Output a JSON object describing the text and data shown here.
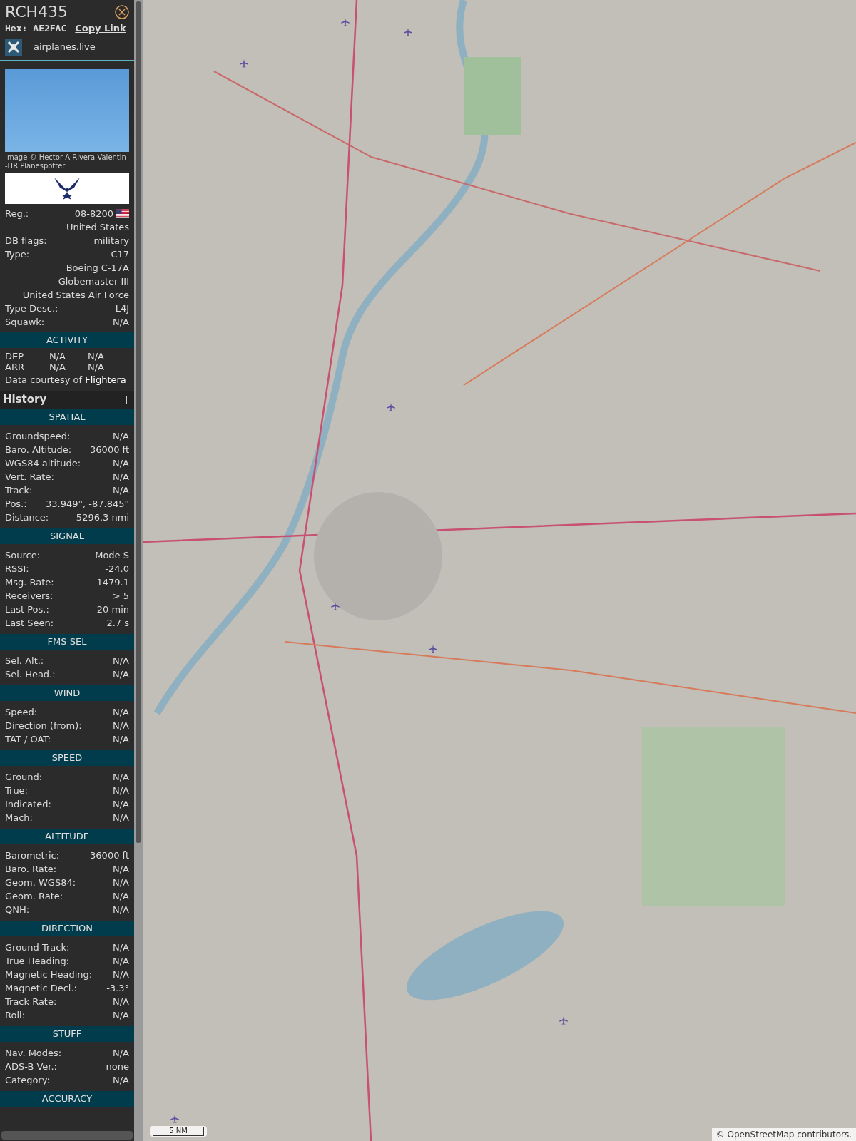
{
  "header": {
    "callsign": "RCH435",
    "hex_label": "Hex:",
    "hex": "AE2FAC",
    "copy_link": "Copy Link",
    "site": "airplanes.live"
  },
  "photo": {
    "credit": "Image © Hector A Rivera Valentin -HR Planespotter"
  },
  "details": [
    {
      "label": "Reg.:",
      "value": "08-8200",
      "flag": true
    },
    {
      "value": "United States",
      "flag": false
    },
    {
      "label": "DB flags:",
      "value": "military",
      "flag": false
    },
    {
      "label": "Type:",
      "value": "C17",
      "flag": false
    },
    {
      "value": "Boeing C-17A Globemaster III",
      "flag": false
    },
    {
      "value": "United States Air Force",
      "flag": false
    },
    {
      "label": "Type Desc.:",
      "value": "L4J",
      "flag": false
    },
    {
      "label": "Squawk:",
      "value": "N/A",
      "flag": false
    }
  ],
  "activity": {
    "title": "ACTIVITY",
    "rows": [
      [
        "DEP",
        "N/A",
        "N/A"
      ],
      [
        "ARR",
        "N/A",
        "N/A"
      ]
    ],
    "courtesy": "Data courtesy of **Flightera**"
  },
  "history": {
    "title": "History",
    "sections": [
      {
        "title": "SPATIAL",
        "rows": [
          {
            "label": "Groundspeed:",
            "value": "N/A"
          },
          {
            "label": "Baro. Altitude:",
            "value": "36000 ft"
          },
          {
            "label": "WGS84 altitude:",
            "value": "N/A"
          },
          {
            "label": "Vert. Rate:",
            "value": "N/A"
          },
          {
            "label": "Track:",
            "value": "N/A"
          },
          {
            "label": "Pos.:",
            "value": "33.949°, -87.845°"
          },
          {
            "label": "Distance:",
            "value": "5296.3 nmi"
          }
        ]
      },
      {
        "title": "SIGNAL",
        "rows": [
          {
            "label": "Source:",
            "value": "Mode S"
          },
          {
            "label": "RSSI:",
            "value": "-24.0"
          },
          {
            "label": "Msg. Rate:",
            "value": "1479.1"
          },
          {
            "label": "Receivers:",
            "value": "> 5"
          },
          {
            "label": "Last Pos.:",
            "value": "20 min"
          },
          {
            "label": "Last Seen:",
            "value": "2.7 s"
          }
        ]
      },
      {
        "title": "FMS SEL",
        "rows": [
          {
            "label": "Sel. Alt.:",
            "value": "N/A"
          },
          {
            "label": "Sel. Head.:",
            "value": "N/A"
          }
        ]
      },
      {
        "title": "WIND",
        "rows": [
          {
            "label": "Speed:",
            "value": "N/A"
          },
          {
            "label": "Direction (from):",
            "value": "N/A"
          },
          {
            "label": "TAT / OAT:",
            "value": "N/A"
          }
        ]
      },
      {
        "title": "SPEED",
        "rows": [
          {
            "label": "Ground:",
            "value": "N/A"
          },
          {
            "label": "True:",
            "value": "N/A"
          },
          {
            "label": "Indicated:",
            "value": "N/A"
          },
          {
            "label": "Mach:",
            "value": "N/A"
          }
        ]
      },
      {
        "title": "ALTITUDE",
        "rows": [
          {
            "label": "Barometric:",
            "value": "36000 ft"
          },
          {
            "label": "Baro. Rate:",
            "value": "N/A"
          },
          {
            "label": "Geom. WGS84:",
            "value": "N/A"
          },
          {
            "label": "Geom. Rate:",
            "value": "N/A"
          },
          {
            "label": "QNH:",
            "value": "N/A"
          }
        ]
      },
      {
        "title": "DIRECTION",
        "rows": [
          {
            "label": "Ground Track:",
            "value": "N/A"
          },
          {
            "label": "True Heading:",
            "value": "N/A"
          },
          {
            "label": "Magnetic Heading:",
            "value": "N/A"
          },
          {
            "label": "Magnetic Decl.:",
            "value": "-3.3°"
          },
          {
            "label": "Track Rate:",
            "value": "N/A"
          },
          {
            "label": "Roll:",
            "value": "N/A"
          }
        ]
      },
      {
        "title": "STUFF",
        "rows": [
          {
            "label": "Nav. Modes:",
            "value": "N/A"
          },
          {
            "label": "ADS-B Ver.:",
            "value": "none"
          },
          {
            "label": "Category:",
            "value": "N/A"
          }
        ]
      },
      {
        "title": "ACCURACY"
      }
    ]
  },
  "map": {
    "scale": "5 NM",
    "attribution": "© OpenStreetMap contributors."
  }
}
